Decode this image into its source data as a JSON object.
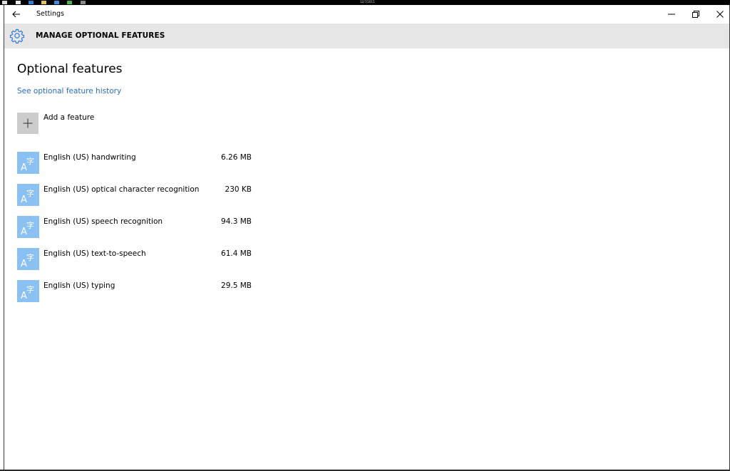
{
  "taskbar": {
    "date": "12/7/2015",
    "icons": [
      "windows-icon",
      "file-icon",
      "edge-icon",
      "explorer-icon",
      "store-icon",
      "skype-icon",
      "settings-icon"
    ]
  },
  "window": {
    "title": "Settings",
    "header_title": "MANAGE OPTIONAL FEATURES",
    "icon": "gear-icon",
    "controls": [
      "minimize-icon",
      "restore-icon",
      "close-icon"
    ]
  },
  "main": {
    "page_title": "Optional features",
    "history_link": "See optional feature history",
    "add_feature_label": "Add a feature",
    "features": [
      {
        "name": "English (US) handwriting",
        "size": "6.26 MB",
        "icon": "language-icon"
      },
      {
        "name": "English (US) optical character recognition",
        "size": "230 KB",
        "icon": "language-icon"
      },
      {
        "name": "English (US) speech recognition",
        "size": "94.3 MB",
        "icon": "language-icon"
      },
      {
        "name": "English (US) text-to-speech",
        "size": "61.4 MB",
        "icon": "language-icon"
      },
      {
        "name": "English (US) typing",
        "size": "29.5 MB",
        "icon": "language-icon"
      }
    ]
  },
  "colors": {
    "accent_link": "#2a6bc2",
    "feature_tile": "#8ac0f2",
    "add_tile": "#cccccc",
    "header_bg": "#e6e6e6",
    "gear": "#2b79d4"
  }
}
